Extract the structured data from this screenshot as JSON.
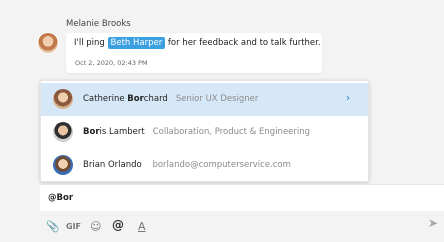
{
  "message": {
    "sender": "Melanie Brooks",
    "text_before": "I'll ping ",
    "mention": "Beth Harper",
    "text_after": " for her feedback and to talk further.",
    "timestamp": "Oct 2, 2020, 02:43 PM"
  },
  "suggestions": [
    {
      "name_prefix": "Catherine ",
      "name_match": "Bor",
      "name_suffix": "chard",
      "subtitle": "Senior UX Designer",
      "chevron": "›"
    },
    {
      "name_prefix": "",
      "name_match": "Bor",
      "name_suffix": "is Lambert",
      "subtitle": "Collaboration, Product & Engineering"
    },
    {
      "name_prefix": "Brian Orlando ",
      "name_match": "",
      "name_suffix": "",
      "subtitle": "borlando@computerservice.com"
    }
  ],
  "composer": {
    "value": "@Bor"
  },
  "toolbar": {
    "gif": "GIF",
    "at": "@",
    "format": "A",
    "attach": "📎",
    "emoji": "☺",
    "send": "➤"
  },
  "colors": {
    "mention_bg": "#3aa0e2",
    "selected_row": "#d6e8f7",
    "chevron": "#2b78c2"
  }
}
